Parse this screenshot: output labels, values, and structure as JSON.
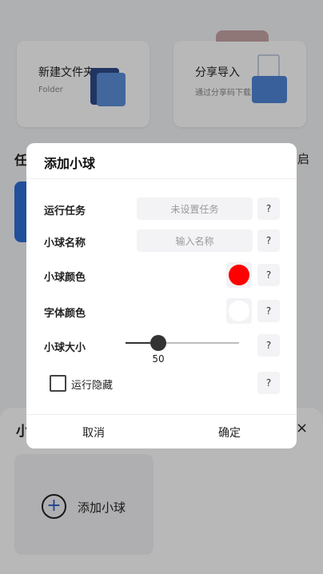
{
  "background": {
    "cards": [
      {
        "title": "新建文件夹",
        "subtitle": "Folder"
      },
      {
        "title": "分享导入",
        "subtitle": "通过分享码下载"
      }
    ],
    "section_left_char": "任",
    "section_right_char": "启",
    "bottom_section_char": "小",
    "close_glyph": "×",
    "add_ball_label": "添加小球",
    "add_icon_glyph": "+"
  },
  "dialog": {
    "title": "添加小球",
    "rows": {
      "task": {
        "label": "运行任务",
        "placeholder": "未设置任务"
      },
      "name": {
        "label": "小球名称",
        "placeholder": "输入名称"
      },
      "ball_color": {
        "label": "小球颜色",
        "color": "#ff0000"
      },
      "font_color": {
        "label": "字体颜色",
        "color": "#ffffff"
      },
      "size": {
        "label": "小球大小",
        "value": "50",
        "fraction": 0.29
      },
      "hide": {
        "label": "运行隐藏",
        "checked": false
      }
    },
    "help_label": "?",
    "cancel_label": "取消",
    "confirm_label": "确定"
  }
}
